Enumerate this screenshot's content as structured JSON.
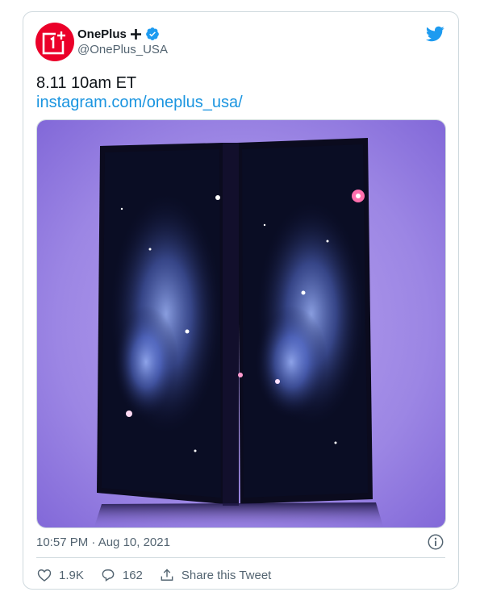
{
  "tweet": {
    "author": {
      "display_name": "OnePlus",
      "handle": "@OnePlus_USA",
      "avatar_icon": "oneplus-logo",
      "verified_icon": "verified-badge-icon",
      "brand_color": "#eb0029"
    },
    "text": "8.11 10am ET",
    "link": "instagram.com/oneplus_usa/",
    "media": {
      "description_icon": "foldable-phone-image"
    },
    "timestamp": "10:57 PM · Aug 10, 2021",
    "actions": {
      "like_count": "1.9K",
      "reply_count": "162",
      "share_label": "Share this Tweet"
    }
  },
  "colors": {
    "link": "#1b95e0",
    "verified": "#1d9bf0",
    "bird": "#1d9bf0",
    "secondary_text": "#536471"
  }
}
